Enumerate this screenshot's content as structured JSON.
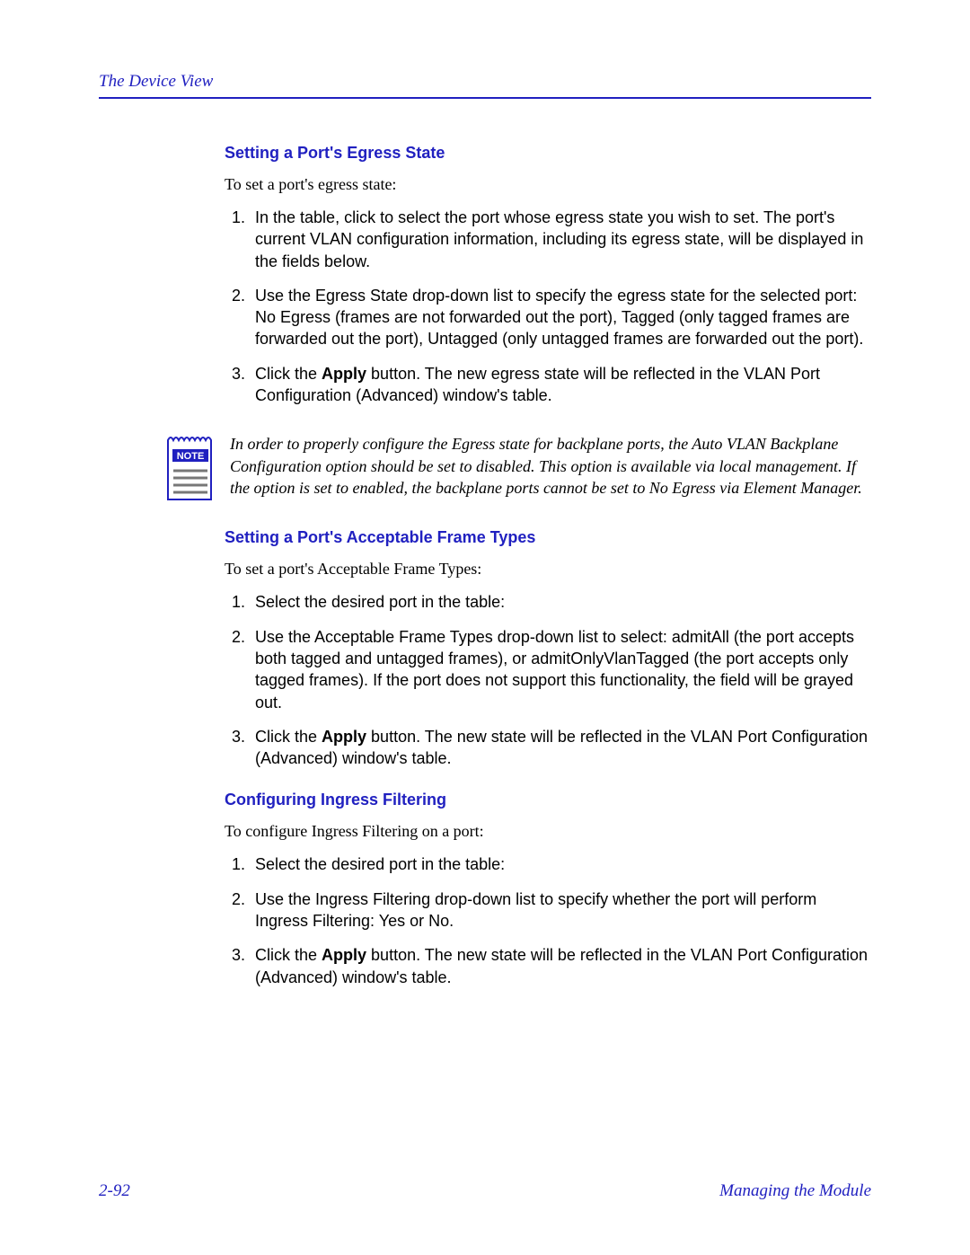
{
  "header": {
    "breadcrumb": "The Device View"
  },
  "sections": {
    "egress": {
      "heading": "Setting a Port's Egress State",
      "intro": "To set a port's egress state:",
      "step1": "In the table, click to select the port whose egress state you wish to set. The port's current VLAN configuration information, including its egress state, will be displayed in the fields below.",
      "step2": "Use the Egress State drop-down list to specify the egress state for the selected port: No Egress (frames are not forwarded out the port), Tagged (only tagged frames are forwarded out the port), Untagged (only untagged frames are forwarded out the port).",
      "step3_pre": "Click the ",
      "step3_bold": "Apply",
      "step3_post": " button. The new egress state will be reflected in the VLAN Port Configuration (Advanced) window's table."
    },
    "note": {
      "label": "NOTE",
      "text": "In order to properly configure the Egress state for backplane ports, the Auto VLAN Backplane Configuration option should be set to disabled. This option is available via local management. If the option is set to enabled, the backplane ports cannot be set to No Egress via Element Manager."
    },
    "frame": {
      "heading": "Setting a Port's Acceptable Frame Types",
      "intro": "To set a port's Acceptable Frame Types:",
      "step1": "Select the desired port in the table:",
      "step2": "Use the Acceptable Frame Types drop-down list to select: admitAll (the port accepts both tagged and untagged frames), or admitOnlyVlanTagged (the port accepts only tagged frames). If the port does not support this functionality, the field will be grayed out.",
      "step3_pre": "Click the ",
      "step3_bold": "Apply",
      "step3_post": " button. The new state will be reflected in the VLAN Port Configuration (Advanced) window's table."
    },
    "ingress": {
      "heading": "Configuring Ingress Filtering",
      "intro": "To configure Ingress Filtering on a port:",
      "step1": "Select the desired port in the table:",
      "step2": "Use the Ingress Filtering drop-down list to specify whether the port will perform Ingress Filtering: Yes or No.",
      "step3_pre": "Click the ",
      "step3_bold": "Apply",
      "step3_post": " button. The new state will be reflected in the VLAN Port Configuration (Advanced) window's table."
    }
  },
  "footer": {
    "page": "2-92",
    "doc": "Managing the Module"
  }
}
